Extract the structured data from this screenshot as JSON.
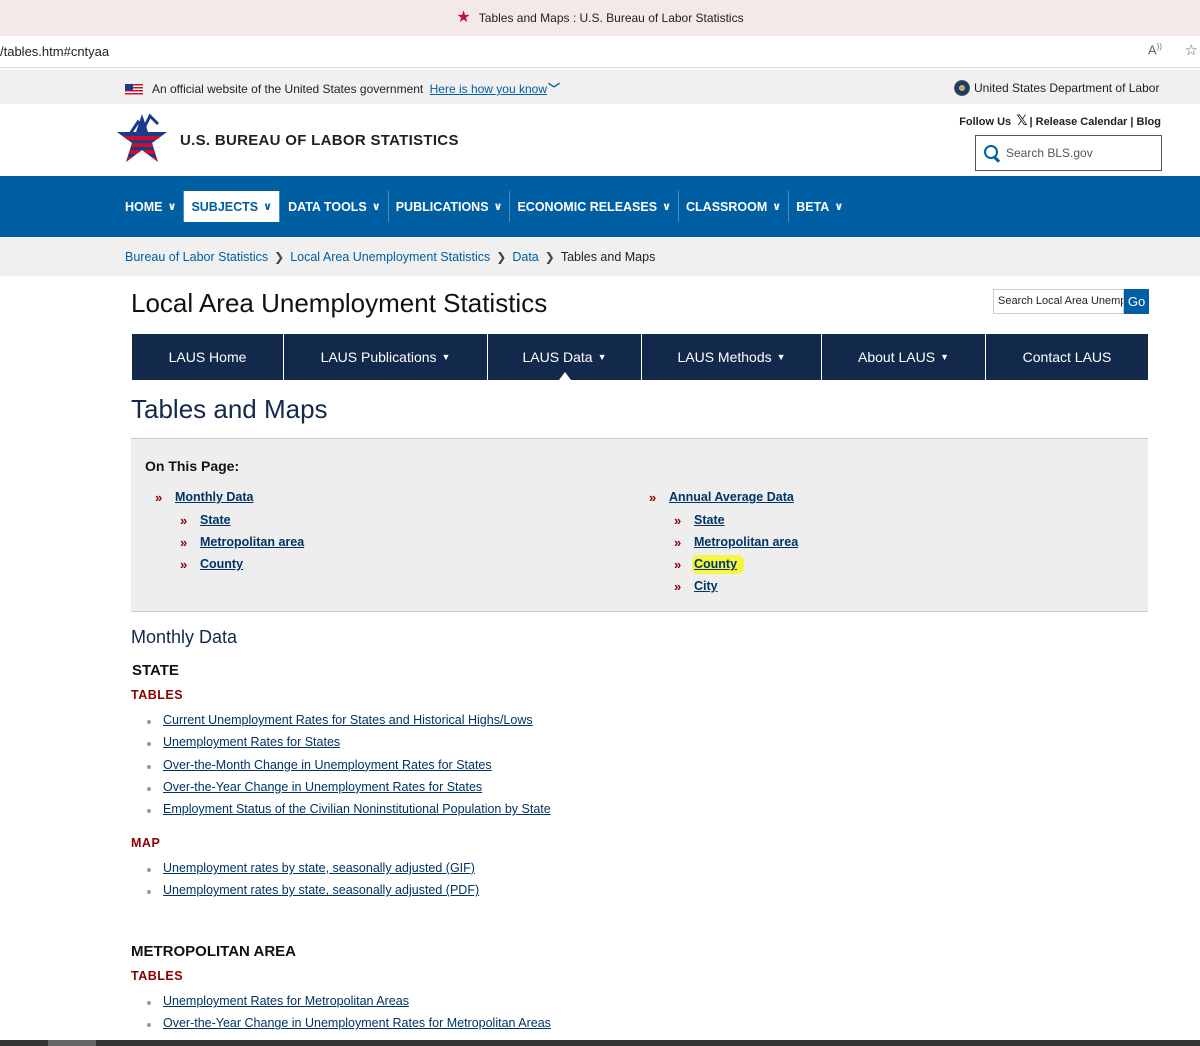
{
  "browser": {
    "tab_title": "Tables and Maps : U.S. Bureau of Labor Statistics",
    "url": "/tables.htm#cntyaa",
    "read_aloud": "Aᴬ"
  },
  "gov_banner": {
    "text": "An official website of the United States government",
    "link": "Here is how you know",
    "dol": "United States Department of Labor"
  },
  "header": {
    "site_name": "U.S. BUREAU OF LABOR STATISTICS",
    "follow_us": "Follow Us",
    "release_calendar": "Release Calendar",
    "blog": "Blog",
    "search_placeholder": "Search BLS.gov"
  },
  "main_nav": [
    {
      "label": "HOME"
    },
    {
      "label": "SUBJECTS"
    },
    {
      "label": "DATA TOOLS"
    },
    {
      "label": "PUBLICATIONS"
    },
    {
      "label": "ECONOMIC RELEASES"
    },
    {
      "label": "CLASSROOM"
    },
    {
      "label": "BETA"
    }
  ],
  "breadcrumb": {
    "items": [
      "Bureau of Labor Statistics",
      "Local Area Unemployment Statistics",
      "Data"
    ],
    "current": "Tables and Maps"
  },
  "page": {
    "title": "Local Area Unemployment Statistics",
    "search_placeholder": "Search Local Area Unemployment Statistics",
    "go": "Go",
    "section_title": "Tables and Maps"
  },
  "laus_nav": [
    {
      "label": "LAUS Home"
    },
    {
      "label": "LAUS Publications"
    },
    {
      "label": "LAUS Data"
    },
    {
      "label": "LAUS Methods"
    },
    {
      "label": "About LAUS"
    },
    {
      "label": "Contact LAUS"
    }
  ],
  "on_this_page": {
    "heading": "On This Page:",
    "monthly": {
      "label": "Monthly Data",
      "items": [
        "State",
        "Metropolitan area",
        "County"
      ]
    },
    "annual": {
      "label": "Annual Average Data",
      "items": [
        "State",
        "Metropolitan area",
        "County",
        "City"
      ]
    }
  },
  "content": {
    "monthly_heading": "Monthly Data",
    "state_heading": "STATE",
    "tables_label": "TABLES",
    "map_label": "MAP",
    "state_tables": [
      "Current Unemployment Rates for States and Historical Highs/Lows",
      "Unemployment Rates for States",
      "Over-the-Month Change in Unemployment Rates for States",
      "Over-the-Year Change in Unemployment Rates for States",
      "Employment Status of the Civilian Noninstitutional Population by State"
    ],
    "state_maps": [
      "Unemployment rates by state, seasonally adjusted (GIF)",
      "Unemployment rates by state, seasonally adjusted (PDF)"
    ],
    "metro_heading": "METROPOLITAN AREA",
    "metro_tables": [
      "Unemployment Rates for Metropolitan Areas",
      "Over-the-Year Change in Unemployment Rates for Metropolitan Areas"
    ]
  },
  "colors": {
    "bls_blue": "#005ea2",
    "laus_navy": "#13294b",
    "accent_red": "#8b0000",
    "highlight": "#f5f542"
  }
}
